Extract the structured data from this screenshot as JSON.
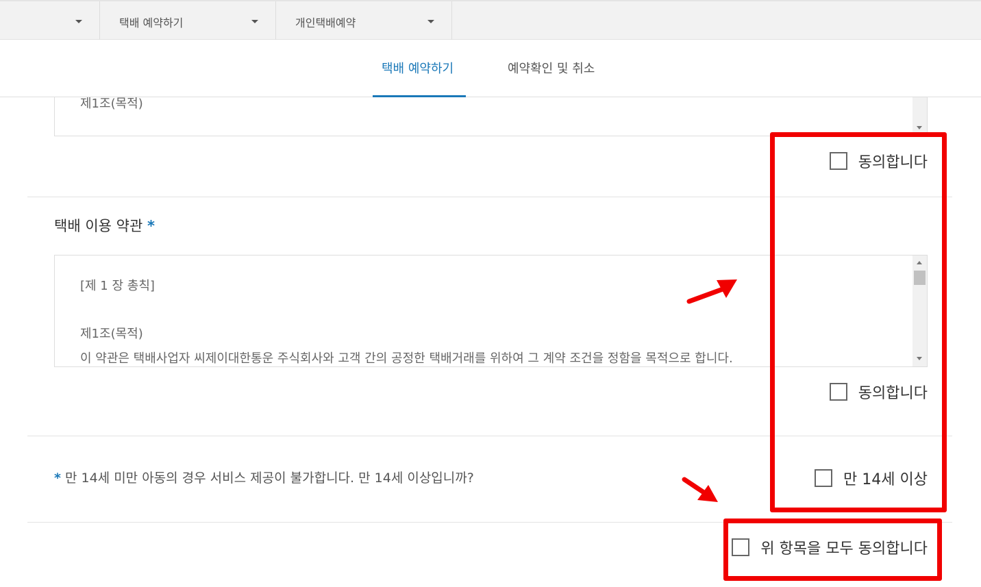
{
  "breadcrumb": {
    "items": [
      {
        "label": ""
      },
      {
        "label": "택배 예약하기"
      },
      {
        "label": "개인택배예약"
      }
    ]
  },
  "tabs": [
    {
      "label": "택배 예약하기",
      "active": true
    },
    {
      "label": "예약확인 및 취소",
      "active": false
    }
  ],
  "privacy_terms": {
    "visible_text": "제1조(목적)",
    "agree_label": "동의합니다"
  },
  "service_terms": {
    "title": "택배 이용 약관",
    "required_mark": "*",
    "lines": [
      "[제 1 장 총칙]",
      "제1조(목적)",
      "이 약관은 택배사업자 씨제이대한통운 주식회사와 고객 간의 공정한 택배거래를 위하여 그 계약 조건을 정함을 목적으로 합니다."
    ],
    "agree_label": "동의합니다"
  },
  "age_check": {
    "required_mark": "*",
    "question": "만 14세 미만 아동의 경우 서비스 제공이 불가합니다. 만 14세 이상입니까?",
    "checkbox_label": "만 14세 이상"
  },
  "agree_all": {
    "label": "위 항목을 모두 동의합니다"
  },
  "colors": {
    "accent": "#1a78b8",
    "annotation_red": "#f10000"
  }
}
